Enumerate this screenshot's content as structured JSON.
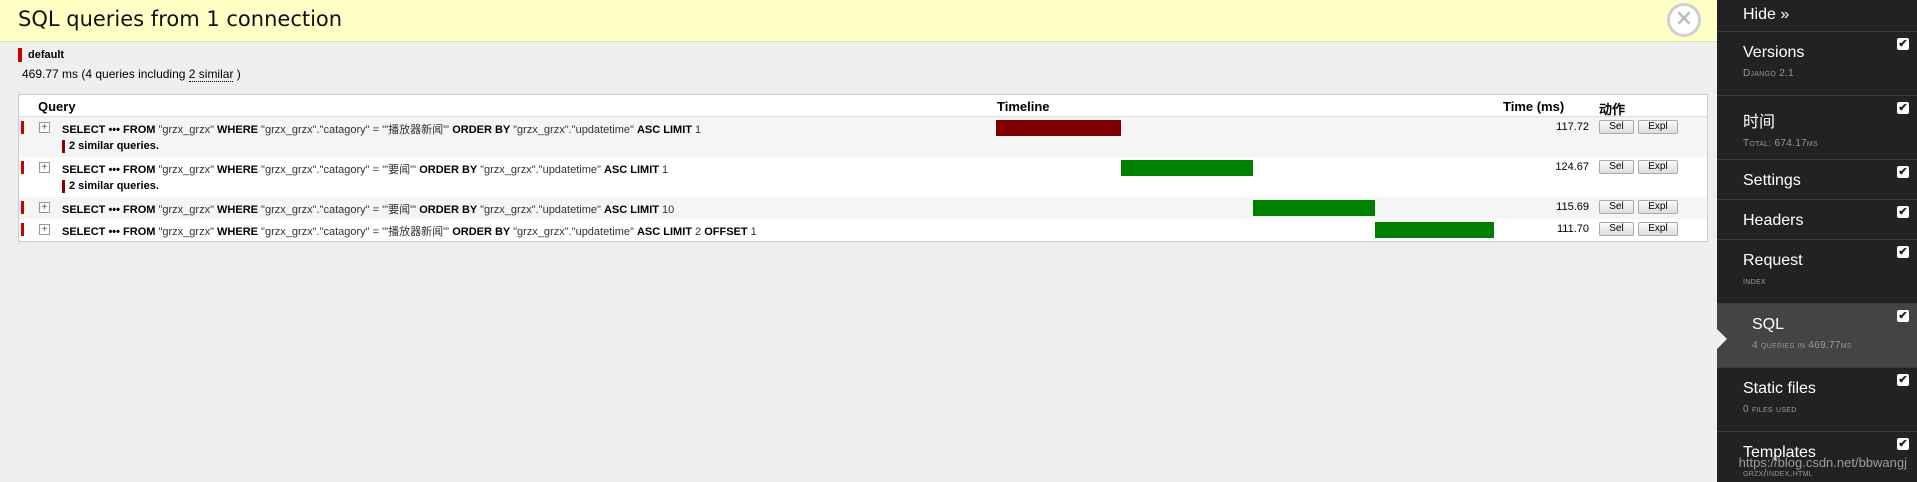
{
  "panel": {
    "title": "SQL queries from 1 connection",
    "close_icon": "×",
    "connection_name": "default",
    "summary_prefix": "469.77 ms (4 queries including ",
    "summary_similar": "2 similar",
    "summary_suffix": " )"
  },
  "table": {
    "headers": {
      "query": "Query",
      "timeline": "Timeline",
      "time": "Time (ms)",
      "action": "动作"
    },
    "rows": [
      {
        "sql_parts": [
          [
            "b",
            "SELECT ••• FROM "
          ],
          [
            "t",
            "\"grzx_grzx\" "
          ],
          [
            "b",
            "WHERE "
          ],
          [
            "t",
            "\"grzx_grzx\".\"catagory\" = '\"播放器新闻\"' "
          ],
          [
            "b",
            "ORDER BY "
          ],
          [
            "t",
            "\"grzx_grzx\".\"updatetime\" "
          ],
          [
            "b",
            "ASC LIMIT "
          ],
          [
            "t",
            "1"
          ]
        ],
        "similar_note": "2 similar queries.",
        "time": "117.72",
        "bar_color": "#800000",
        "bar_start_pct": 0,
        "bar_width_pct": 25.1,
        "sel_label": "Sel",
        "expl_label": "Expl"
      },
      {
        "sql_parts": [
          [
            "b",
            "SELECT ••• FROM "
          ],
          [
            "t",
            "\"grzx_grzx\" "
          ],
          [
            "b",
            "WHERE "
          ],
          [
            "t",
            "\"grzx_grzx\".\"catagory\" = '\"要闻\"' "
          ],
          [
            "b",
            "ORDER BY "
          ],
          [
            "t",
            "\"grzx_grzx\".\"updatetime\" "
          ],
          [
            "b",
            "ASC LIMIT "
          ],
          [
            "t",
            "1"
          ]
        ],
        "similar_note": "2 similar queries.",
        "time": "124.67",
        "bar_color": "#008000",
        "bar_start_pct": 25.1,
        "bar_width_pct": 26.5,
        "sel_label": "Sel",
        "expl_label": "Expl"
      },
      {
        "sql_parts": [
          [
            "b",
            "SELECT ••• FROM "
          ],
          [
            "t",
            "\"grzx_grzx\" "
          ],
          [
            "b",
            "WHERE "
          ],
          [
            "t",
            "\"grzx_grzx\".\"catagory\" = '\"要闻\"' "
          ],
          [
            "b",
            "ORDER BY "
          ],
          [
            "t",
            "\"grzx_grzx\".\"updatetime\" "
          ],
          [
            "b",
            "ASC LIMIT "
          ],
          [
            "t",
            "10"
          ]
        ],
        "similar_note": "",
        "time": "115.69",
        "bar_color": "#008000",
        "bar_start_pct": 51.6,
        "bar_width_pct": 24.6,
        "sel_label": "Sel",
        "expl_label": "Expl"
      },
      {
        "sql_parts": [
          [
            "b",
            "SELECT ••• FROM "
          ],
          [
            "t",
            "\"grzx_grzx\" "
          ],
          [
            "b",
            "WHERE "
          ],
          [
            "t",
            "\"grzx_grzx\".\"catagory\" = '\"播放器新闻\"' "
          ],
          [
            "b",
            "ORDER BY "
          ],
          [
            "t",
            "\"grzx_grzx\".\"updatetime\" "
          ],
          [
            "b",
            "ASC LIMIT "
          ],
          [
            "t",
            "2 "
          ],
          [
            "b",
            "OFFSET "
          ],
          [
            "t",
            "1"
          ]
        ],
        "similar_note": "",
        "time": "111.70",
        "bar_color": "#008000",
        "bar_start_pct": 76.2,
        "bar_width_pct": 23.8,
        "sel_label": "Sel",
        "expl_label": "Expl"
      }
    ]
  },
  "sidebar": {
    "hide_label": "Hide »",
    "items": [
      {
        "label": "Versions",
        "sub": "Django 2.1",
        "checked": true,
        "active": false
      },
      {
        "label": "时间",
        "sub": "Total: 674.17ms",
        "checked": true,
        "active": false
      },
      {
        "label": "Settings",
        "sub": "",
        "checked": true,
        "active": false
      },
      {
        "label": "Headers",
        "sub": "",
        "checked": true,
        "active": false
      },
      {
        "label": "Request",
        "sub": "index",
        "checked": true,
        "active": false
      },
      {
        "label": "SQL",
        "sub": "4 queries in 469.77ms",
        "checked": true,
        "active": true
      },
      {
        "label": "Static files",
        "sub": "0 files used",
        "checked": true,
        "active": false
      },
      {
        "label": "Templates",
        "sub": "grzx/index.html",
        "checked": true,
        "active": false
      }
    ],
    "check_icon": "✔"
  },
  "watermark": "https://blog.csdn.net/bbwangj"
}
